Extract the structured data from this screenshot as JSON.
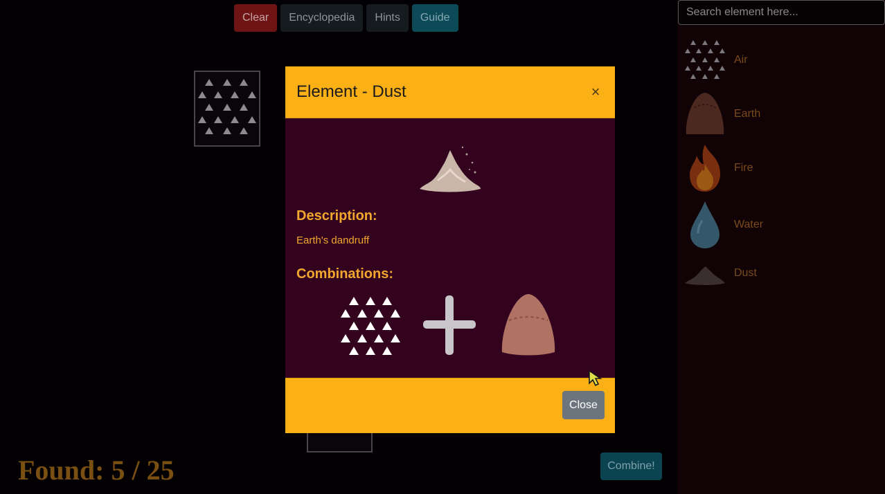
{
  "toolbar": {
    "clear_label": "Clear",
    "encyclopedia_label": "Encyclopedia",
    "hints_label": "Hints",
    "guide_label": "Guide"
  },
  "workspace": {
    "tiles": [
      {
        "element": "Air",
        "icon": "air-icon"
      },
      {
        "element": "",
        "icon": "hidden-tile"
      }
    ]
  },
  "status": {
    "found_text": "Found: 5 / 25",
    "found_count": 5,
    "total_count": 25
  },
  "combine_label": "Combine!",
  "sidebar": {
    "search_placeholder": "Search element here...",
    "items": [
      {
        "label": "Air",
        "icon": "air-icon"
      },
      {
        "label": "Earth",
        "icon": "earth-icon"
      },
      {
        "label": "Fire",
        "icon": "fire-icon"
      },
      {
        "label": "Water",
        "icon": "water-drop-icon"
      },
      {
        "label": "Dust",
        "icon": "dust-icon"
      }
    ]
  },
  "modal": {
    "title": "Element - Dust",
    "close_x": "×",
    "description_heading": "Description:",
    "description": "Earth's dandruff",
    "combinations_heading": "Combinations:",
    "combination": [
      "air-icon",
      "plus-icon",
      "earth-icon"
    ],
    "close_label": "Close"
  },
  "colors": {
    "modal_accent": "#fbb016",
    "modal_body": "#33021e",
    "text_accent": "#f2a72f",
    "clear_button": "#6e1414",
    "guide_button": "#0d4a57",
    "found_text": "#7a5012"
  }
}
